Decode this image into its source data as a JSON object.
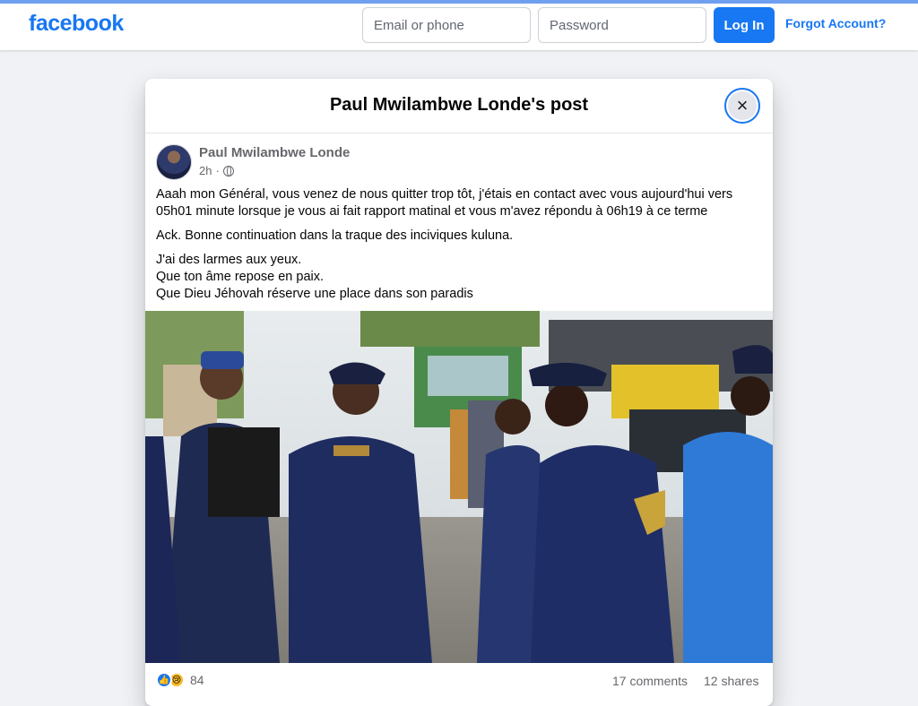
{
  "header": {
    "logo": "facebook",
    "email_placeholder": "Email or phone",
    "password_placeholder": "Password",
    "login_label": "Log In",
    "forgot_label": "Forgot Account?"
  },
  "modal": {
    "title": "Paul Mwilambwe Londe's post",
    "close_icon": "×"
  },
  "post": {
    "author": "Paul Mwilambwe Londe",
    "time": "2h",
    "separator": "·",
    "paragraph_1_line_1": "Aaah mon Général, vous venez de nous quitter trop tôt, j'étais en contact avec vous aujourd'hui vers",
    "paragraph_1_line_2": "05h01 minute lorsque je vous ai fait rapport matinal et vous m'avez répondu à 06h19 à ce terme",
    "paragraph_2": "Ack. Bonne continuation dans la traque des inciviques kuluna.",
    "paragraph_3_line_1": "J'ai des larmes aux yeux.",
    "paragraph_3_line_2": "Que ton âme repose en paix.",
    "paragraph_3_line_3": "Que Dieu Jéhovah réserve une place dans son paradis"
  },
  "footer": {
    "reaction_count": "84",
    "comments": "17 comments",
    "shares": "12 shares"
  },
  "colors": {
    "brand": "#1877f2",
    "background": "#f0f2f5",
    "muted_text": "#65676b"
  },
  "icons": {
    "close": "close-icon",
    "privacy": "globe-icon",
    "like": "like-icon",
    "sad": "sad-icon"
  }
}
